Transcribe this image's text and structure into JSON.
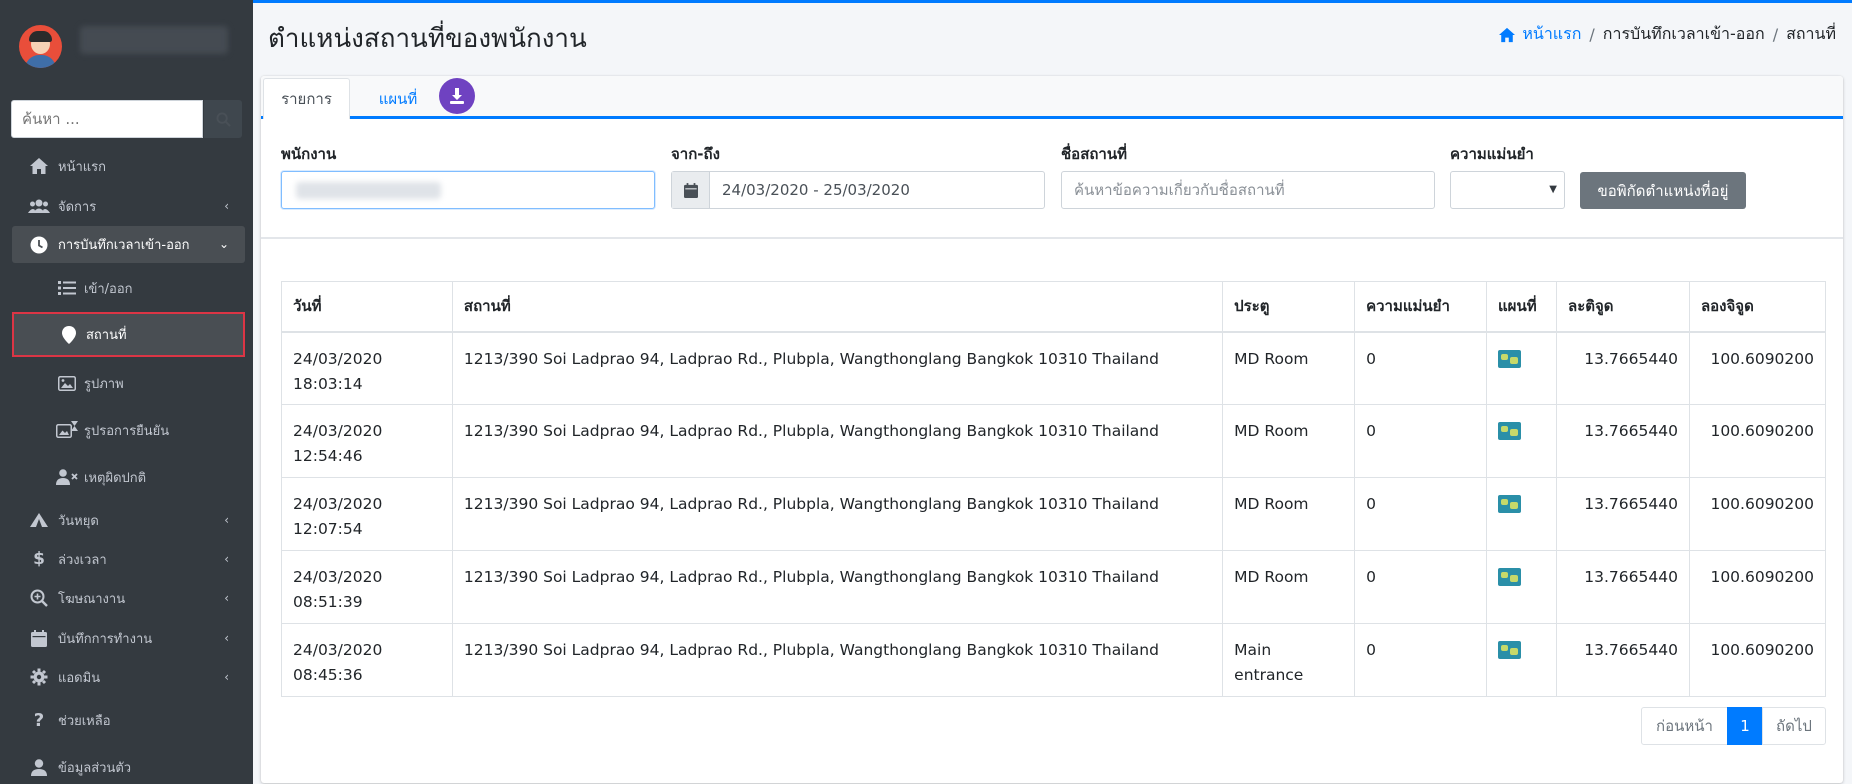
{
  "colors": {
    "sidebar": "#343a40",
    "primary": "#007bff",
    "purple": "#6f42c1",
    "active_border": "#dc3545",
    "button_gray": "#6c757d"
  },
  "sidebar": {
    "search_placeholder": "ค้นหา ...",
    "items": [
      {
        "label": "หน้าแรก",
        "icon": "home-icon"
      },
      {
        "label": "จัดการ",
        "icon": "users-icon"
      },
      {
        "label": "การบันทึกเวลาเข้า-ออก",
        "icon": "clock-icon"
      },
      {
        "label": "เข้า/ออก",
        "icon": "list-icon"
      },
      {
        "label": "สถานที่",
        "icon": "map-pin-icon"
      },
      {
        "label": "รูปภาพ",
        "icon": "image-icon"
      },
      {
        "label": "รูปรอการยืนยัน",
        "icon": "images-pending-icon"
      },
      {
        "label": "เหตุผิดปกติ",
        "icon": "user-x-icon"
      },
      {
        "label": "วันหยุด",
        "icon": "tent-icon"
      },
      {
        "label": "ล่วงเวลา",
        "icon": "dollar-icon"
      },
      {
        "label": "โฆษณางาน",
        "icon": "search-plus-icon"
      },
      {
        "label": "บันทึกการทำงาน",
        "icon": "calendar-icon"
      },
      {
        "label": "แอดมิน",
        "icon": "gear-icon"
      },
      {
        "label": "ช่วยเหลือ",
        "icon": "question-icon"
      },
      {
        "label": "ข้อมูลส่วนตัว",
        "icon": "user-icon"
      }
    ]
  },
  "header": {
    "title": "ตำแหน่งสถานที่ของพนักงาน",
    "breadcrumb": [
      "หน้าแรก",
      "การบันทึกเวลาเข้า-ออก",
      "สถานที่"
    ]
  },
  "tabs": {
    "list": "รายการ",
    "map": "แผนที่"
  },
  "filters": {
    "employee_label": "พนักงาน",
    "date_label": "จาก-ถึง",
    "date_value": "24/03/2020 - 25/03/2020",
    "place_label": "ชื่อสถานที่",
    "place_placeholder": "ค้นหาข้อความเกี่ยวกับชื่อสถานที่",
    "accuracy_label": "ความแม่นยำ",
    "request_button": "ขอพิกัดตำแหน่งที่อยู่"
  },
  "table": {
    "columns": [
      "วันที่",
      "สถานที่",
      "ประตู",
      "ความแม่นยำ",
      "แผนที่",
      "ละติจูด",
      "ลองจิจูด"
    ],
    "rows": [
      {
        "date": "24/03/2020",
        "time": "18:03:14",
        "place": "1213/390 Soi Ladprao 94, Ladprao Rd., Plubpla, Wangthonglang Bangkok 10310 Thailand",
        "gate": "MD Room",
        "accuracy": "0",
        "lat": "13.7665440",
        "lng": "100.6090200"
      },
      {
        "date": "24/03/2020",
        "time": "12:54:46",
        "place": "1213/390 Soi Ladprao 94, Ladprao Rd., Plubpla, Wangthonglang Bangkok 10310 Thailand",
        "gate": "MD Room",
        "accuracy": "0",
        "lat": "13.7665440",
        "lng": "100.6090200"
      },
      {
        "date": "24/03/2020",
        "time": "12:07:54",
        "place": "1213/390 Soi Ladprao 94, Ladprao Rd., Plubpla, Wangthonglang Bangkok 10310 Thailand",
        "gate": "MD Room",
        "accuracy": "0",
        "lat": "13.7665440",
        "lng": "100.6090200"
      },
      {
        "date": "24/03/2020",
        "time": "08:51:39",
        "place": "1213/390 Soi Ladprao 94, Ladprao Rd., Plubpla, Wangthonglang Bangkok 10310 Thailand",
        "gate": "MD Room",
        "accuracy": "0",
        "lat": "13.7665440",
        "lng": "100.6090200"
      },
      {
        "date": "24/03/2020",
        "time": "08:45:36",
        "place": "1213/390 Soi Ladprao 94, Ladprao Rd., Plubpla, Wangthonglang Bangkok 10310 Thailand",
        "gate": "Main entrance",
        "accuracy": "0",
        "lat": "13.7665440",
        "lng": "100.6090200"
      }
    ]
  },
  "pagination": {
    "prev": "ก่อนหน้า",
    "page": "1",
    "next": "ถัดไป"
  }
}
